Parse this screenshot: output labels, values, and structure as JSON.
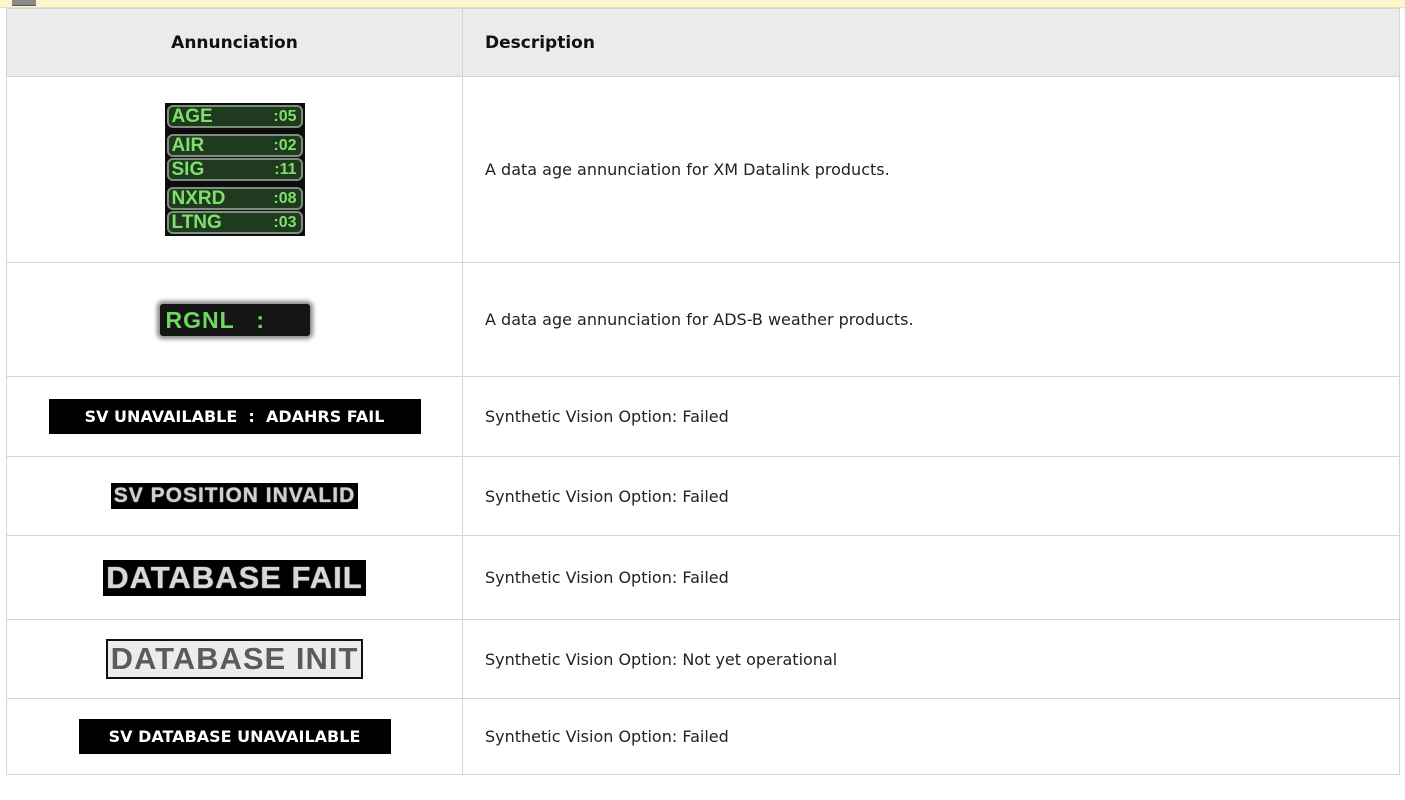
{
  "header": {
    "annunciation": "Annunciation",
    "description": "Description"
  },
  "rows": [
    {
      "tags": [
        {
          "label": "AGE",
          "value": ":05"
        },
        {
          "label": "AIR",
          "value": ":02"
        },
        {
          "label": "SIG",
          "value": ":11"
        },
        {
          "label": "NXRD",
          "value": ":08"
        },
        {
          "label": "LTNG",
          "value": ":03"
        }
      ],
      "description": "A data age annunciation for XM Datalink products."
    },
    {
      "annunciation": "RGNL   :",
      "description": "A data age annunciation for ADS-B weather products."
    },
    {
      "annunciation": "SV UNAVAILABLE  :  ADAHRS FAIL",
      "description": "Synthetic Vision Option: Failed"
    },
    {
      "annunciation": "SV POSITION INVALID",
      "description": "Synthetic Vision Option: Failed"
    },
    {
      "annunciation": "DATABASE FAIL",
      "description": "Synthetic Vision Option: Failed"
    },
    {
      "annunciation": "DATABASE INIT",
      "description": "Synthetic Vision Option: Not yet operational"
    },
    {
      "annunciation": "SV DATABASE UNAVAILABLE",
      "description": "Synthetic Vision Option: Failed"
    }
  ],
  "colors": {
    "header_bg": "#ebebeb",
    "datalink_green": "#7ee06b",
    "annunciation_black": "#000000",
    "top_strip": "#fdf7cf"
  }
}
